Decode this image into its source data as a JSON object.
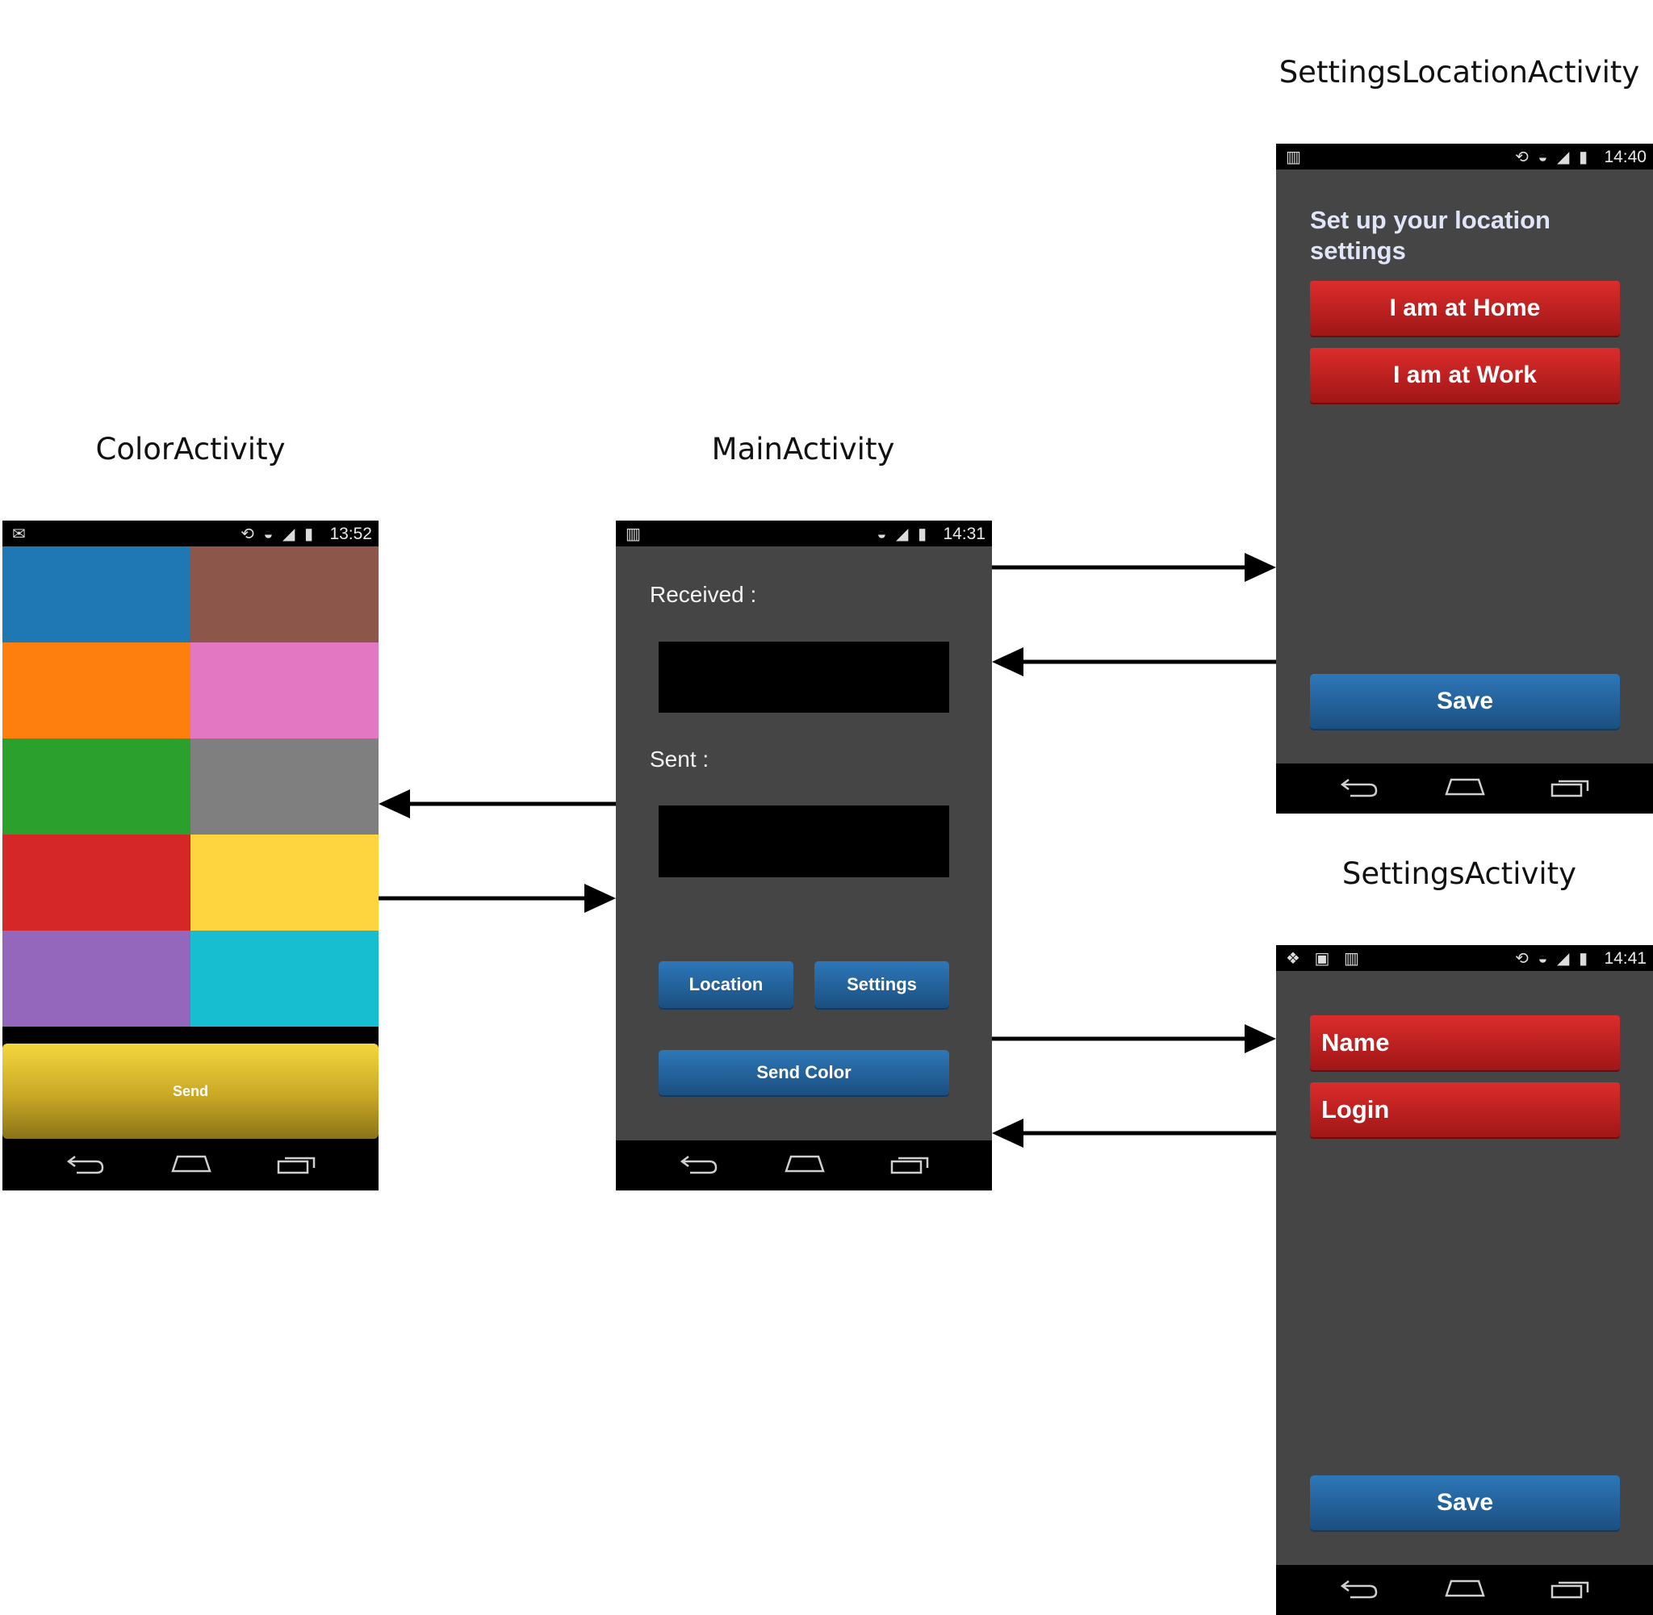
{
  "labels": {
    "settings_location": "SettingsLocationActivity",
    "color": "ColorActivity",
    "main": "MainActivity",
    "settings": "SettingsActivity"
  },
  "color_activity": {
    "time": "13:52",
    "colors": [
      "#1f77b4",
      "#8c564b",
      "#ff7f0e",
      "#e377c2",
      "#2ca02c",
      "#7f7f7f",
      "#d62728",
      "#ffd53f",
      "#9467bd",
      "#17becf"
    ],
    "send_label": "Send"
  },
  "main_activity": {
    "time": "14:31",
    "received_label": "Received :",
    "sent_label": "Sent :",
    "location_button": "Location",
    "settings_button": "Settings",
    "send_color_button": "Send Color"
  },
  "settings_location_activity": {
    "time": "14:40",
    "heading": "Set up your location settings",
    "home_button": "I am at Home",
    "work_button": "I am at Work",
    "save_button": "Save"
  },
  "settings_activity": {
    "time": "14:41",
    "name_button": "Name",
    "login_button": "Login",
    "save_button": "Save"
  },
  "icons": {
    "back": "back-icon",
    "home": "home-icon",
    "recents": "recents-icon"
  }
}
